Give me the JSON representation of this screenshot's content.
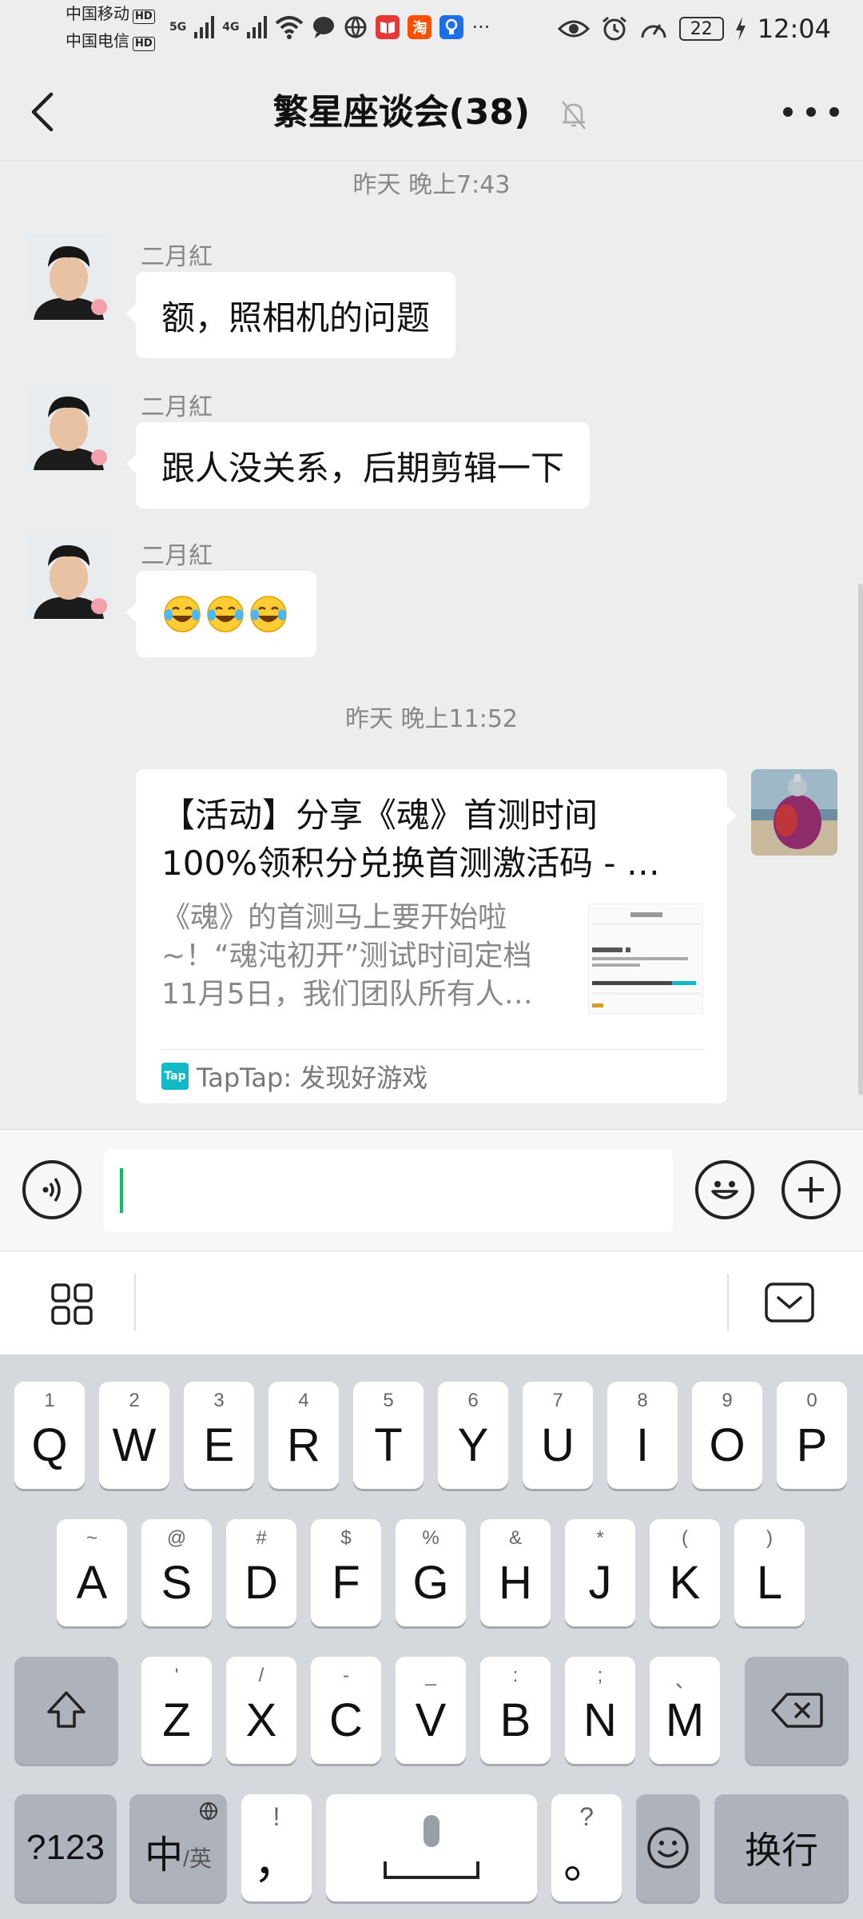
{
  "status_bar": {
    "carrier1": "中国移动",
    "carrier2": "中国电信",
    "hd": "HD",
    "net1": "5G",
    "net2": "4G",
    "app_taobao": "淘",
    "more": "···",
    "battery": "22",
    "time": "12:04"
  },
  "nav": {
    "title": "繁星座谈会(38)"
  },
  "messages": {
    "ts1": "昨天 晚上7:43",
    "ts2": "昨天 晚上11:52",
    "m1_sender": "二月紅",
    "m1_text": "额，照相机的问题",
    "m2_sender": "二月紅",
    "m2_text": "跟人没关系，后期剪辑一下",
    "m3_sender": "二月紅",
    "m3_emoji": "😂😂😂"
  },
  "link_card": {
    "title_line1": "【活动】分享《魂》首测时间",
    "title_line2": "100%领积分兑换首测激活码 - …",
    "desc_line1": "《魂》的首测马上要开始啦",
    "desc_line2": "~！“魂沌初开”测试时间定档",
    "desc_line3": "11月5日，我们团队所有人…",
    "source": "TapTap: 发现好游戏",
    "logo_text": "Tap"
  },
  "keyboard": {
    "row1": [
      {
        "main": "Q",
        "sub": "1"
      },
      {
        "main": "W",
        "sub": "2"
      },
      {
        "main": "E",
        "sub": "3"
      },
      {
        "main": "R",
        "sub": "4"
      },
      {
        "main": "T",
        "sub": "5"
      },
      {
        "main": "Y",
        "sub": "6"
      },
      {
        "main": "U",
        "sub": "7"
      },
      {
        "main": "I",
        "sub": "8"
      },
      {
        "main": "O",
        "sub": "9"
      },
      {
        "main": "P",
        "sub": "0"
      }
    ],
    "row2": [
      {
        "main": "A",
        "sub": "~"
      },
      {
        "main": "S",
        "sub": "@"
      },
      {
        "main": "D",
        "sub": "#"
      },
      {
        "main": "F",
        "sub": "$"
      },
      {
        "main": "G",
        "sub": "%"
      },
      {
        "main": "H",
        "sub": "&"
      },
      {
        "main": "J",
        "sub": "*"
      },
      {
        "main": "K",
        "sub": "("
      },
      {
        "main": "L",
        "sub": ")"
      }
    ],
    "row3": [
      {
        "main": "Z",
        "sub": "'"
      },
      {
        "main": "X",
        "sub": "/"
      },
      {
        "main": "C",
        "sub": "-"
      },
      {
        "main": "V",
        "sub": "_"
      },
      {
        "main": "B",
        "sub": ":"
      },
      {
        "main": "N",
        "sub": ";"
      },
      {
        "main": "M",
        "sub": "、"
      }
    ],
    "num_key": "?123",
    "lang_main": "中",
    "lang_sub": "/英",
    "comma_main": "，",
    "comma_sub": "!",
    "period_main": "。",
    "period_sub": "?",
    "enter": "换行"
  }
}
